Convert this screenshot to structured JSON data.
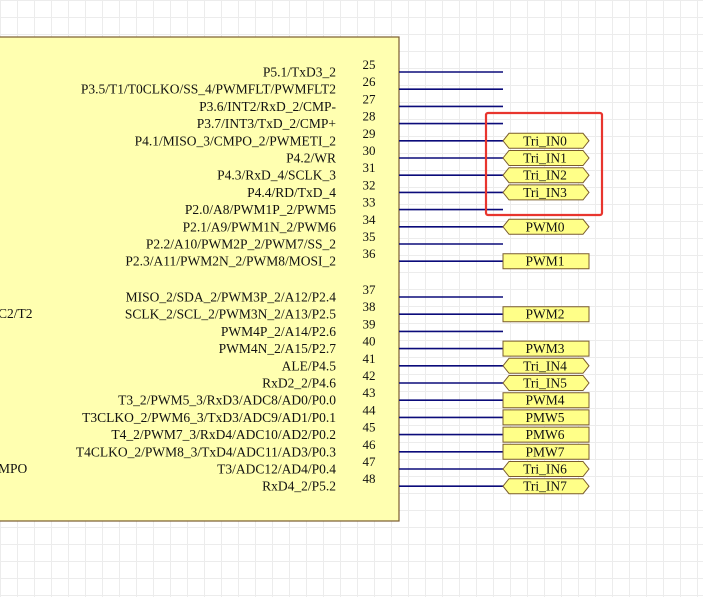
{
  "colors": {
    "chip_fill": "#ffffb0",
    "chip_border": "#7a5c2e",
    "wire": "#0b0b7a",
    "label_fill": "#ffff88",
    "label_border": "#7a5c2e",
    "highlight": "#e8352e"
  },
  "left_labels": [
    "C2/T2",
    "MPO"
  ],
  "pins": [
    {
      "num": "25",
      "name": "P5.1/TxD3_2"
    },
    {
      "num": "26",
      "name": "P3.5/T1/T0CLKO/SS_4/PWMFLT/PWMFLT2"
    },
    {
      "num": "27",
      "name": "P3.6/INT2/RxD_2/CMP-"
    },
    {
      "num": "28",
      "name": "P3.7/INT3/TxD_2/CMP+"
    },
    {
      "num": "29",
      "name": "P4.1/MISO_3/CMPO_2/PWMETI_2",
      "net": "Tri_IN0",
      "port": true
    },
    {
      "num": "30",
      "name": "P4.2/WR",
      "net": "Tri_IN1",
      "port": true
    },
    {
      "num": "31",
      "name": "P4.3/RxD_4/SCLK_3",
      "net": "Tri_IN2",
      "port": true
    },
    {
      "num": "32",
      "name": "P4.4/RD/TxD_4",
      "net": "Tri_IN3",
      "port": true
    },
    {
      "num": "33",
      "name": "P2.0/A8/PWM1P_2/PWM5"
    },
    {
      "num": "34",
      "name": "P2.1/A9/PWM1N_2/PWM6",
      "net": "PWM0",
      "port": true
    },
    {
      "num": "35",
      "name": "P2.2/A10/PWM2P_2/PWM7/SS_2"
    },
    {
      "num": "36",
      "name": "P2.3/A11/PWM2N_2/PWM8/MOSI_2",
      "net": "PWM1",
      "port": false
    },
    {
      "num": "37",
      "name": "MISO_2/SDA_2/PWM3P_2/A12/P2.4"
    },
    {
      "num": "38",
      "name": "SCLK_2/SCL_2/PWM3N_2/A13/P2.5",
      "net": "PWM2",
      "port": false
    },
    {
      "num": "39",
      "name": "PWM4P_2/A14/P2.6"
    },
    {
      "num": "40",
      "name": "PWM4N_2/A15/P2.7",
      "net": "PWM3",
      "port": false
    },
    {
      "num": "41",
      "name": "ALE/P4.5",
      "net": "Tri_IN4",
      "port": true
    },
    {
      "num": "42",
      "name": "RxD2_2/P4.6",
      "net": "Tri_IN5",
      "port": true
    },
    {
      "num": "43",
      "name": "T3_2/PWM5_3/RxD3/ADC8/AD0/P0.0",
      "net": "PWM4",
      "port": false
    },
    {
      "num": "44",
      "name": "T3CLKO_2/PWM6_3/TxD3/ADC9/AD1/P0.1",
      "net": "PMW5",
      "port": false
    },
    {
      "num": "45",
      "name": "T4_2/PWM7_3/RxD4/ADC10/AD2/P0.2",
      "net": "PMW6",
      "port": false
    },
    {
      "num": "46",
      "name": "T4CLKO_2/PWM8_3/TxD4/ADC11/AD3/P0.3",
      "net": "PMW7",
      "port": false
    },
    {
      "num": "47",
      "name": "T3/ADC12/AD4/P0.4",
      "net": "Tri_IN6",
      "port": true
    },
    {
      "num": "48",
      "name": "RxD4_2/P5.2",
      "net": "Tri_IN7",
      "port": true
    }
  ]
}
